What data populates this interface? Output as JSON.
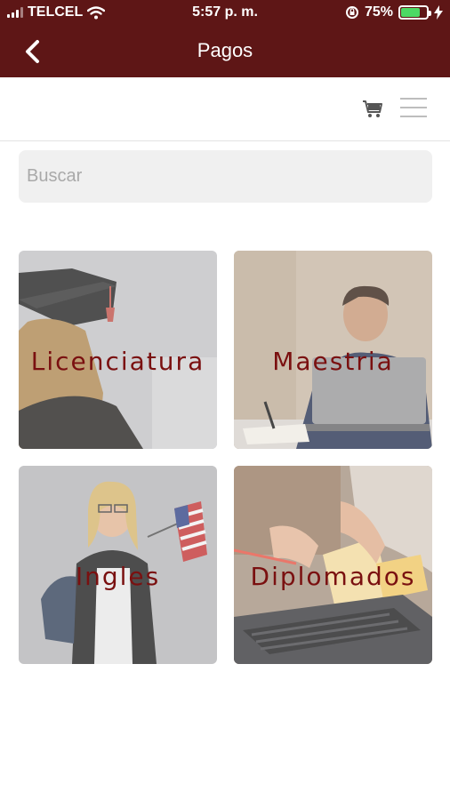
{
  "status_bar": {
    "carrier": "TELCEL",
    "time": "5:57 p. m.",
    "battery": "75%",
    "battery_level": 0.75
  },
  "header": {
    "title": "Pagos"
  },
  "search": {
    "placeholder": "Buscar"
  },
  "categories": [
    {
      "label": "Licenciatura"
    },
    {
      "label": "Maestria"
    },
    {
      "label": "Ingles"
    },
    {
      "label": "Diplomados"
    }
  ]
}
